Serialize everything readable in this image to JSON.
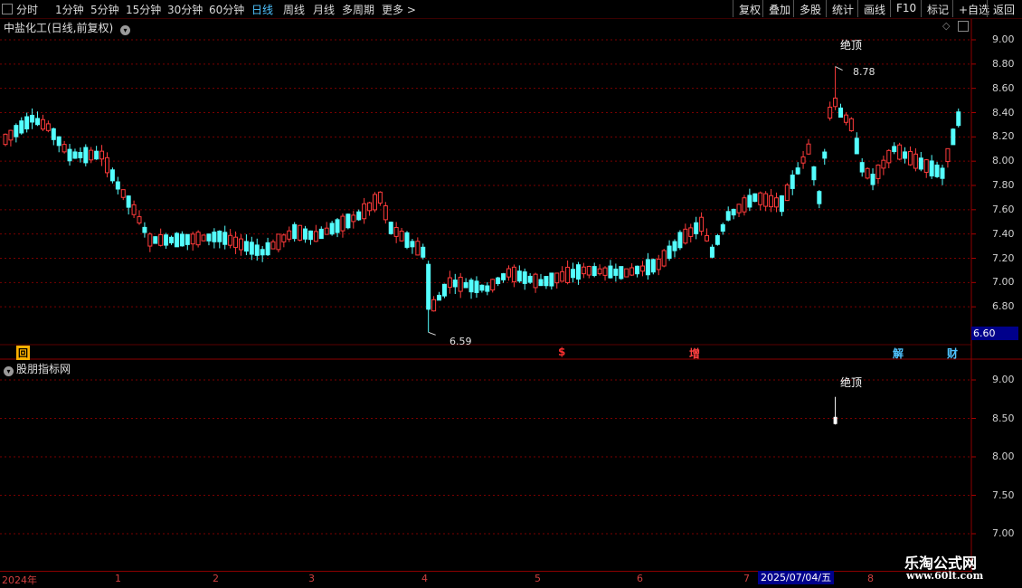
{
  "toolbar": {
    "periods": [
      "分时",
      "1分钟",
      "5分钟",
      "15分钟",
      "30分钟",
      "60分钟",
      "日线",
      "周线",
      "月线",
      "多周期",
      "更多 >"
    ],
    "active_period": "日线",
    "right_buttons": [
      "复权",
      "叠加",
      "多股",
      "统计",
      "画线",
      "F10",
      "标记",
      "+自选",
      "返回"
    ]
  },
  "main_panel": {
    "title": "中盐化工(日线,前复权)",
    "price_axis": [
      "9.00",
      "8.80",
      "8.60",
      "8.40",
      "8.20",
      "8.00",
      "7.80",
      "7.60",
      "7.40",
      "7.20",
      "7.00",
      "6.80",
      "6.60"
    ],
    "current_price_tag": "6.60",
    "high_label": "8.78",
    "low_label": "6.59",
    "signal_label": "绝顶",
    "event_tags": [
      {
        "text": "回",
        "color": "#ffb000"
      },
      {
        "text": "$",
        "color": "#ff3030"
      },
      {
        "text": "增",
        "color": "#ff4040"
      },
      {
        "text": "解",
        "color": "#4fc3ff"
      },
      {
        "text": "财",
        "color": "#4fc3ff"
      }
    ]
  },
  "indicator_panel": {
    "title": "股朋指标网",
    "price_axis": [
      "9.00",
      "8.50",
      "8.00",
      "7.50",
      "7.00"
    ],
    "signal_label": "绝顶"
  },
  "date_axis": {
    "labels": [
      "2024年",
      "1",
      "2",
      "3",
      "4",
      "5",
      "6",
      "7",
      "8"
    ],
    "highlight": "2025/07/04/五"
  },
  "watermark": {
    "title": "乐淘公式网",
    "url": "www.60lt.com"
  },
  "colors": {
    "up": "#ff3b3b",
    "down": "#54ffff",
    "grid": "#7a0000",
    "accent": "#4fc3ff"
  },
  "chart_data": {
    "type": "candlestick",
    "title": "中盐化工(日线,前复权)",
    "ylim": [
      6.55,
      9.08
    ],
    "x": [
      "2024年",
      "1",
      "2",
      "3",
      "4",
      "5",
      "6",
      "7",
      "8"
    ],
    "highlight_date": "2025/07/04/五",
    "annotations": [
      {
        "text": "8.78",
        "y": 8.78
      },
      {
        "text": "6.59",
        "y": 6.59
      },
      {
        "text": "绝顶",
        "y": 8.9
      }
    ],
    "indicator_signal": {
      "text": "绝顶",
      "y": 8.5
    }
  }
}
